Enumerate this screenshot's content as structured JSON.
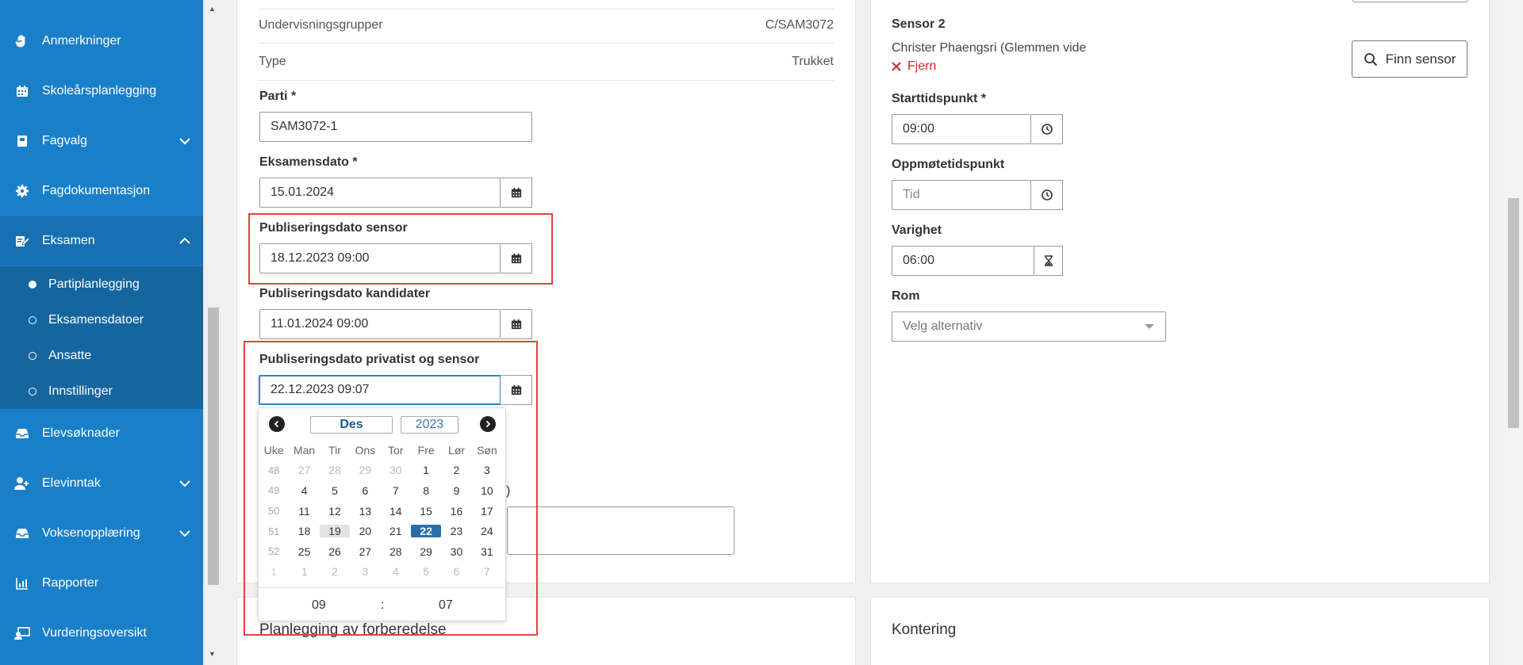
{
  "sidebar": {
    "items": [
      {
        "label": "Anmerkninger",
        "icon": "hand-icon"
      },
      {
        "label": "Skoleårsplanlegging",
        "icon": "calendar-icon"
      },
      {
        "label": "Fagvalg",
        "icon": "book-icon"
      },
      {
        "label": "Fagdokumentasjon",
        "icon": "gear-icon"
      },
      {
        "label": "Eksamen",
        "icon": "exam-edit-icon"
      },
      {
        "label": "Elevsøknader",
        "icon": "inbox-icon"
      },
      {
        "label": "Elevinntak",
        "icon": "user-add-icon"
      },
      {
        "label": "Voksenopplæring",
        "icon": "inbox-icon"
      },
      {
        "label": "Rapporter",
        "icon": "bar-chart-icon"
      },
      {
        "label": "Vurderingsoversikt",
        "icon": "monitor-user-icon"
      }
    ],
    "eksamen_sub": [
      {
        "label": "Partiplanlegging",
        "active": true
      },
      {
        "label": "Eksamensdatoer",
        "active": false
      },
      {
        "label": "Ansatte",
        "active": false
      },
      {
        "label": "Innstillinger",
        "active": false
      }
    ]
  },
  "left": {
    "undervisningsgrupper_label": "Undervisningsgrupper",
    "undervisningsgrupper_value": "C/SAM3072",
    "type_label": "Type",
    "type_value": "Trukket",
    "parti_label": "Parti *",
    "parti_value": "SAM3072-1",
    "eksamensdato_label": "Eksamensdato *",
    "eksamensdato_value": "15.01.2024",
    "pub_sensor_label": "Publiseringsdato sensor",
    "pub_sensor_value": "18.12.2023 09:00",
    "pub_kandidater_label": "Publiseringsdato kandidater",
    "pub_kandidater_value": "11.01.2024 09:00",
    "pub_privatist_label": "Publiseringsdato privatist og sensor",
    "pub_privatist_value": "22.12.2023 09:07",
    "partial_label": ")"
  },
  "datepicker": {
    "month": "Des",
    "year": "2023",
    "headers": [
      "Uke",
      "Man",
      "Tir",
      "Ons",
      "Tor",
      "Fre",
      "Lør",
      "Søn"
    ],
    "weeks": [
      {
        "wk": "48",
        "days": [
          "27",
          "28",
          "29",
          "30",
          "1",
          "2",
          "3"
        ]
      },
      {
        "wk": "49",
        "days": [
          "4",
          "5",
          "6",
          "7",
          "8",
          "9",
          "10"
        ]
      },
      {
        "wk": "50",
        "days": [
          "11",
          "12",
          "13",
          "14",
          "15",
          "16",
          "17"
        ]
      },
      {
        "wk": "51",
        "days": [
          "18",
          "19",
          "20",
          "21",
          "22",
          "23",
          "24"
        ]
      },
      {
        "wk": "52",
        "days": [
          "25",
          "26",
          "27",
          "28",
          "29",
          "30",
          "31"
        ]
      },
      {
        "wk": "1",
        "days": [
          "1",
          "2",
          "3",
          "4",
          "5",
          "6",
          "7"
        ]
      }
    ],
    "hour": "09",
    "separator": ":",
    "minute": "07"
  },
  "right": {
    "sensor2_label": "Sensor 2",
    "sensor2_name": "Christer Phaengsri (Glemmen vide",
    "remove_label": "Fjern",
    "find_sensor_label": "Finn sensor",
    "start_label": "Starttidspunkt *",
    "start_value": "09:00",
    "oppmote_label": "Oppmøtetidspunkt",
    "oppmote_placeholder": "Tid",
    "varighet_label": "Varighet",
    "varighet_value": "06:00",
    "rom_label": "Rom",
    "rom_placeholder": "Velg alternativ"
  },
  "bottom": {
    "planlegging_title": "Planlegging av forberedelse",
    "kontering_title": "Kontering"
  },
  "colors": {
    "sidebar": "#1a7fc9",
    "highlight": "#e5423e",
    "selected_day": "#2a6ea8",
    "remove": "#d12c2c"
  }
}
